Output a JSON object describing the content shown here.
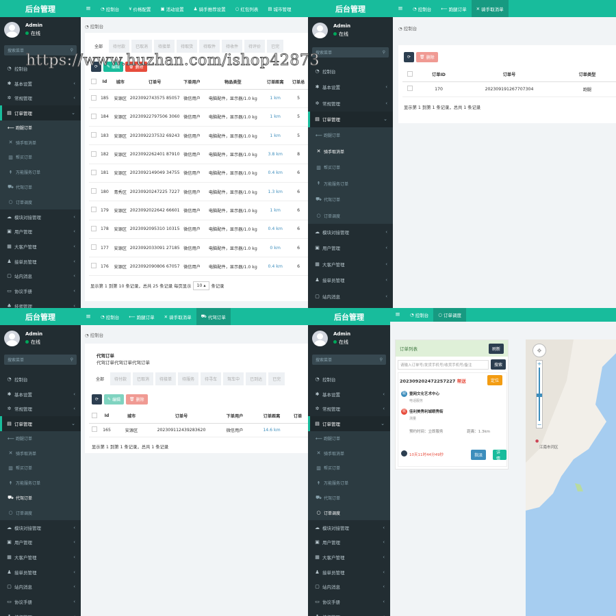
{
  "watermark": "https://www.huzhan.com/ishop42873",
  "brand": "后台管理",
  "user": {
    "name": "Admin",
    "status": "在线"
  },
  "search_placeholder": "搜索菜单",
  "menu": {
    "dashboard": "控制台",
    "basic": "基本设置",
    "regular": "常规管理",
    "order": "订单管理",
    "errand": "跑腿订单",
    "rider_cancel": "骑手取消单",
    "buy": "帮买订单",
    "universal": "万能服务订单",
    "driver": "代驾订单",
    "dispatch": "订单调度",
    "module": "模块对接管理",
    "users": "用户管理",
    "big_customer": "大客户管理",
    "taker": "接单员管理",
    "inbox": "站内消息",
    "agreement": "协议手册",
    "tech": "技师管理"
  },
  "q1": {
    "tabs": [
      "控制台",
      "价格配置",
      "活动设置",
      "骑手推荐设置",
      "红包列表",
      "城市管理"
    ],
    "crumb": "控制台",
    "filters": [
      "全部",
      "待付款",
      "已取消",
      "待接单",
      "待取货",
      "待取件",
      "待收件",
      "待评价",
      "已完"
    ],
    "btn_edit": "编辑",
    "btn_del": "删除",
    "headers": [
      "Id",
      "城市",
      "订单号",
      "下单用户",
      "物品类型",
      "订单距离",
      "订单总"
    ],
    "rows": [
      [
        "185",
        "安源区",
        "2023092743575 85057",
        "微信用户",
        "电脑配件，显示器/1.0 kg",
        "1 km",
        "5"
      ],
      [
        "184",
        "安源区",
        "20230922797506 3060",
        "微信用户",
        "电脑配件，显示器/1.0 kg",
        "1 km",
        "5"
      ],
      [
        "183",
        "安源区",
        "2023092237532 69243",
        "微信用户",
        "电脑配件，显示器/1.0 kg",
        "1 km",
        "5"
      ],
      [
        "182",
        "安源区",
        "2023092262401 87910",
        "微信用户",
        "电脑配件，显示器/1.0 kg",
        "3.8 km",
        "8"
      ],
      [
        "181",
        "安源区",
        "2023092149049 34755",
        "微信用户",
        "电脑配件，显示器/1.0 kg",
        "0.4 km",
        "6"
      ],
      [
        "180",
        "青秀区",
        "20230920247225 7227",
        "微信用户",
        "电脑配件，显示器/1.0 kg",
        "1.3 km",
        "6"
      ],
      [
        "179",
        "安源区",
        "2023092022642 66601",
        "微信用户",
        "电脑配件，显示器/1.0 kg",
        "1 km",
        "6"
      ],
      [
        "178",
        "安源区",
        "2023092095310 10315",
        "微信用户",
        "电脑配件，显示器/1.0 kg",
        "0.4 km",
        "6"
      ],
      [
        "177",
        "安源区",
        "2023092033091 27185",
        "微信用户",
        "电脑配件，显示器/1.0 kg",
        "0 km",
        "6"
      ],
      [
        "176",
        "安源区",
        "2023092090806 67057",
        "微信用户",
        "电脑配件，显示器/1.0 kg",
        "0.4 km",
        "6"
      ]
    ],
    "pagination": "显示第 1 到第 10 条记录，总共 25 条记录 每页显示",
    "page_size": "10",
    "pagination_end": "条记录"
  },
  "q2": {
    "tabs": [
      "控制台",
      "跑腿订单",
      "骑手取消单"
    ],
    "crumb": "控制台",
    "btn_del": "删除",
    "headers": [
      "订单ID",
      "订单号",
      "订单类型"
    ],
    "rows": [
      [
        "170",
        "202309191267707304",
        "跑腿"
      ]
    ],
    "pagination": "显示第 1 到第 1 条记录，总共 1 条记录"
  },
  "q3": {
    "tabs": [
      "控制台",
      "跑腿订单",
      "骑手取消单",
      "代驾订单"
    ],
    "crumb": "控制台",
    "title": "代驾订单",
    "subtitle": "代驾订单代驾订单代驾订单",
    "filters": [
      "全部",
      "待付款",
      "已取消",
      "待接单",
      "待服务",
      "待寻车",
      "驾车中",
      "已到达",
      "已完"
    ],
    "btn_edit": "编辑",
    "btn_del": "删除",
    "headers": [
      "Id",
      "城市",
      "订单号",
      "下单用户",
      "订单距离",
      "订单"
    ],
    "rows": [
      [
        "165",
        "安源区",
        "202309112439283620",
        "微信用户",
        "14.6 km",
        ""
      ]
    ],
    "pagination": "显示第 1 到第 1 条记录，总共 1 条记录"
  },
  "q4": {
    "tabs": [
      "控制台",
      "订单调度"
    ],
    "list_title": "订单列表",
    "refresh": "刷新",
    "search_placeholder": "请输入订单号/发货手机号/收货手机号/备注",
    "search_btn": "搜索",
    "order_no": "202309202472257227",
    "order_type": "帮送",
    "locate": "定位",
    "from_name": "壹网文化艺术中心",
    "from_sub": "电话服务",
    "to_name": "佳利美秀利城眼秀街",
    "to_sub": "测量",
    "appoint": "预约时间：立即服务",
    "distance": "距离：1.3km",
    "countdown": "10天11时44分49秒",
    "assign": "指派",
    "detail": "详情",
    "map_label": "江南市河区"
  },
  "colors": {
    "brand": "#18bc9c",
    "sidebar": "#222d32"
  }
}
